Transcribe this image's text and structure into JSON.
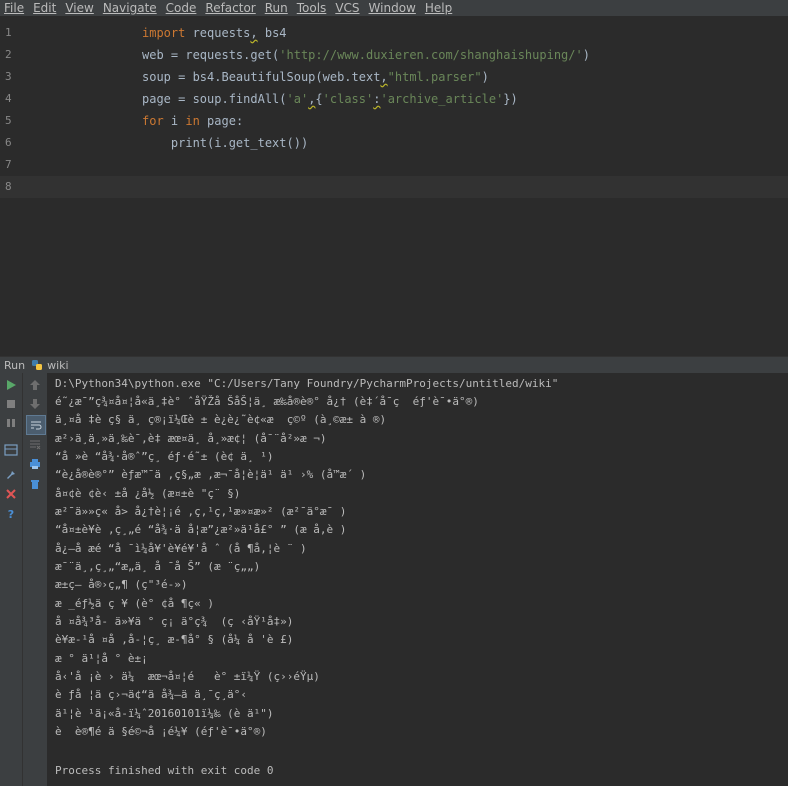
{
  "menubar": {
    "items": [
      "File",
      "Edit",
      "View",
      "Navigate",
      "Code",
      "Refactor",
      "Run",
      "Tools",
      "VCS",
      "Window",
      "Help"
    ]
  },
  "editor": {
    "line_numbers": [
      "1",
      "2",
      "3",
      "4",
      "5",
      "6",
      "7",
      "8"
    ],
    "lines": [
      "import requests, bs4",
      "web = requests.get('http://www.duxieren.com/shanghaishuping/')",
      "soup = bs4.BeautifulSoup(web.text,\"html.parser\")",
      "page = soup.findAll('a',{'class':'archive_article'})",
      "for i in page:",
      "    print(i.get_text())",
      "",
      ""
    ]
  },
  "run_panel": {
    "title": "Run",
    "config_name": "wiki"
  },
  "console": {
    "lines": [
      "D:\\Python34\\python.exe \"C:/Users/Tany Foundry/PycharmProjects/untitled/wiki\"",
      "é˜¿æ¯”ç¾¤å¤¦å«ä¸‡è° ˆåŸŽå ŠåŠ¦ä¸ æ‰å®è®° å¿† (è‡´å¯ç  éƒ'è¯•ä°®)",
      "ä¸¤å ‡è ç§ ä¸ ç®¡ï¼Œè ± è¿è¿˜è¢«æ  ç©º (à¸©æ± à ®)",
      "æ²›ä¸ä¸»ä¸‰è¯‚è‡ æœ¤ä¸ å¸»æ¢¦ (å¯¨å²»æ ¬)",
      "“å »è “å¾·å®ˆ”ç¸ éƒ·é˜± (è¢ ä¸ ¹)",
      "“è¿å®è®°” èƒæ™¯ä ‚ç§„æ ‚æ¬¯å¦è¦ä¹ ä¹ ›% (å­™æ´ )",
      "å¤¢è ¢è‹ ±å ¿å½ (æ¤±è \"ç¨ §)",
      "æ²¯ä»»ç« å> å¿†è¦¡é ,ç,¹ç,¹æ»¤æ»² (æ²¯ä°æ¯ )",
      "“å¤±è¥è ,ç¸„é “å¾·ä å¦æ”¿æ²»ä¹å£° ” (æ å‚­è )",
      "å¿–å æé “å ¯ì¼å¥'è¥é¥'å ˆ (å ¶å‚¦è ¨ )",
      "æ¯¨ä¸‚ç¸„“æ„ä¸ å ¯å Š” (æ ¨ç„„)",
      "æ±ç– å®›ç„¶ (ç\"³é-»)",
      "æ _éƒ½ä ç ¥ (è° ¢å ¶ç« )",
      "å ¤å¾³å- ä»¥ä ° ç¡ ä°ç¾  (ç ‹åŸ¹å‡»)",
      "è¥æ-¹å ¤å ‚å-¦ç¸ æ-¶å° § (å¼ å 'è £)",
      "æ ° ä¹¦å ° è±¡",
      "å‹'å ¡è › ä¼  æœ¬å¤¦é   è° ±ï¼Ÿ (ç››éŸµ)",
      "è ƒå ¦ä ç›¬ä¢“ä å¾–ä ä¸¯ç¸ä°‹",
      "ä¹¦è ¹ä¡«å-­ï¼ˆ20160101ï¼‰ (è ä¹\")",
      "è  è®¶é ä §é©¬å ¡é¼¥ (éƒ'è¯•ä°®)",
      "",
      "Process finished with exit code 0"
    ]
  }
}
